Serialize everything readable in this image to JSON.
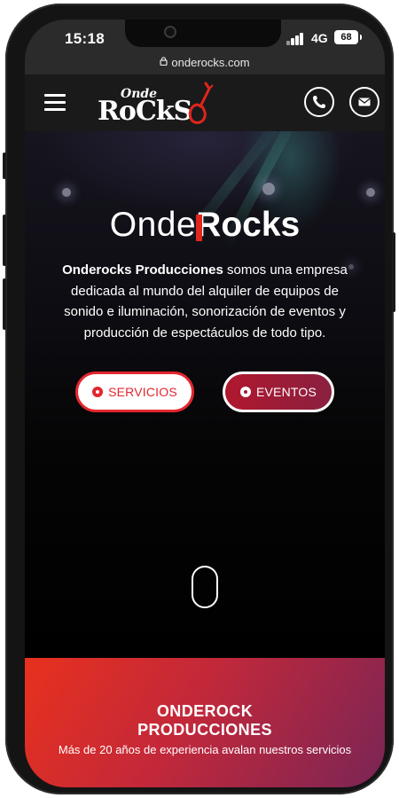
{
  "status": {
    "time": "15:18",
    "network": "4G",
    "battery": "68"
  },
  "browser": {
    "url": "onderocks.com"
  },
  "nav": {
    "logo_small": "Onde",
    "logo_big": "RoCkS",
    "phone_icon": "phone-icon",
    "mail_icon": "mail-icon",
    "menu_icon": "hamburger-menu-icon"
  },
  "hero": {
    "title_light": "Onde",
    "title_bold": "Rocks",
    "desc_bold": "Onderocks Producciones",
    "desc_rest": " somos una empresa dedicada al mundo del alquiler de equipos de sonido e iluminación, sonorización de eventos y producción de espectáculos de todo tipo.",
    "btn_services": "SERVICIOS",
    "btn_events": "EVENTOS",
    "scroll_icon": "mouse-scroll-icon"
  },
  "band": {
    "title_line1": "ONDEROCK",
    "title_line2": "PRODUCCIONES",
    "subtitle": "Más de 20 años de experiencia avalan nuestros servicios"
  },
  "colors": {
    "brand_red": "#e3262f",
    "accent_purple": "#7a2555",
    "nav_bg": "#1a1a1a"
  }
}
